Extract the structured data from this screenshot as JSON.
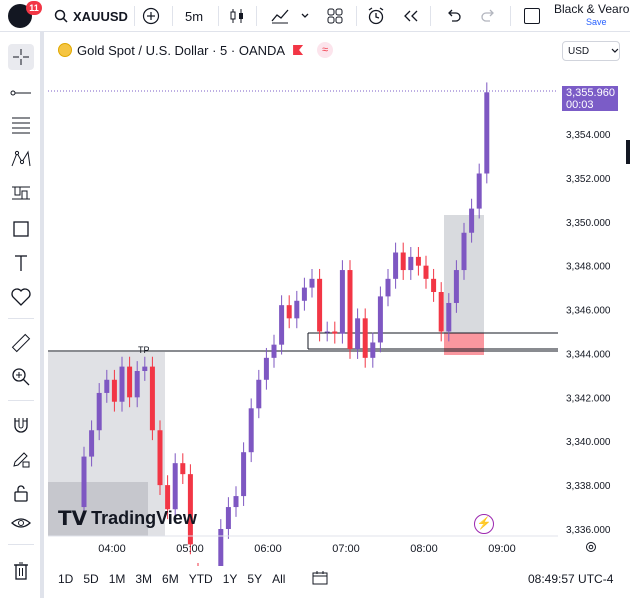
{
  "header": {
    "notification_count": "11",
    "symbol": "XAUUSD",
    "interval": "5m",
    "layout_name": "Black & Vearo",
    "save_label": "Save"
  },
  "legend": {
    "title": "Gold Spot / U.S. Dollar · 5 · OANDA"
  },
  "currency": "USD",
  "last_price": {
    "value": "3,355.960",
    "countdown": "00:03"
  },
  "bottom": {
    "timeframes": [
      "1D",
      "5D",
      "1M",
      "3M",
      "6M",
      "YTD",
      "1Y",
      "5Y",
      "All"
    ],
    "clock": "08:49:57 UTC-4"
  },
  "brand": "TradingView",
  "chart_data": {
    "type": "candlestick",
    "y_ticks": [
      "3,354.000",
      "3,352.000",
      "3,350.000",
      "3,348.000",
      "3,346.000",
      "3,344.000",
      "3,342.000",
      "3,340.000",
      "3,338.000",
      "3,336.000"
    ],
    "x_ticks": [
      "04:00",
      "05:00",
      "06:00",
      "07:00",
      "08:00",
      "09:00"
    ],
    "annotations": [
      "TP"
    ],
    "colors": {
      "up": "#7e57c2",
      "down": "#f23645",
      "accent": "#7b5cc7"
    }
  }
}
